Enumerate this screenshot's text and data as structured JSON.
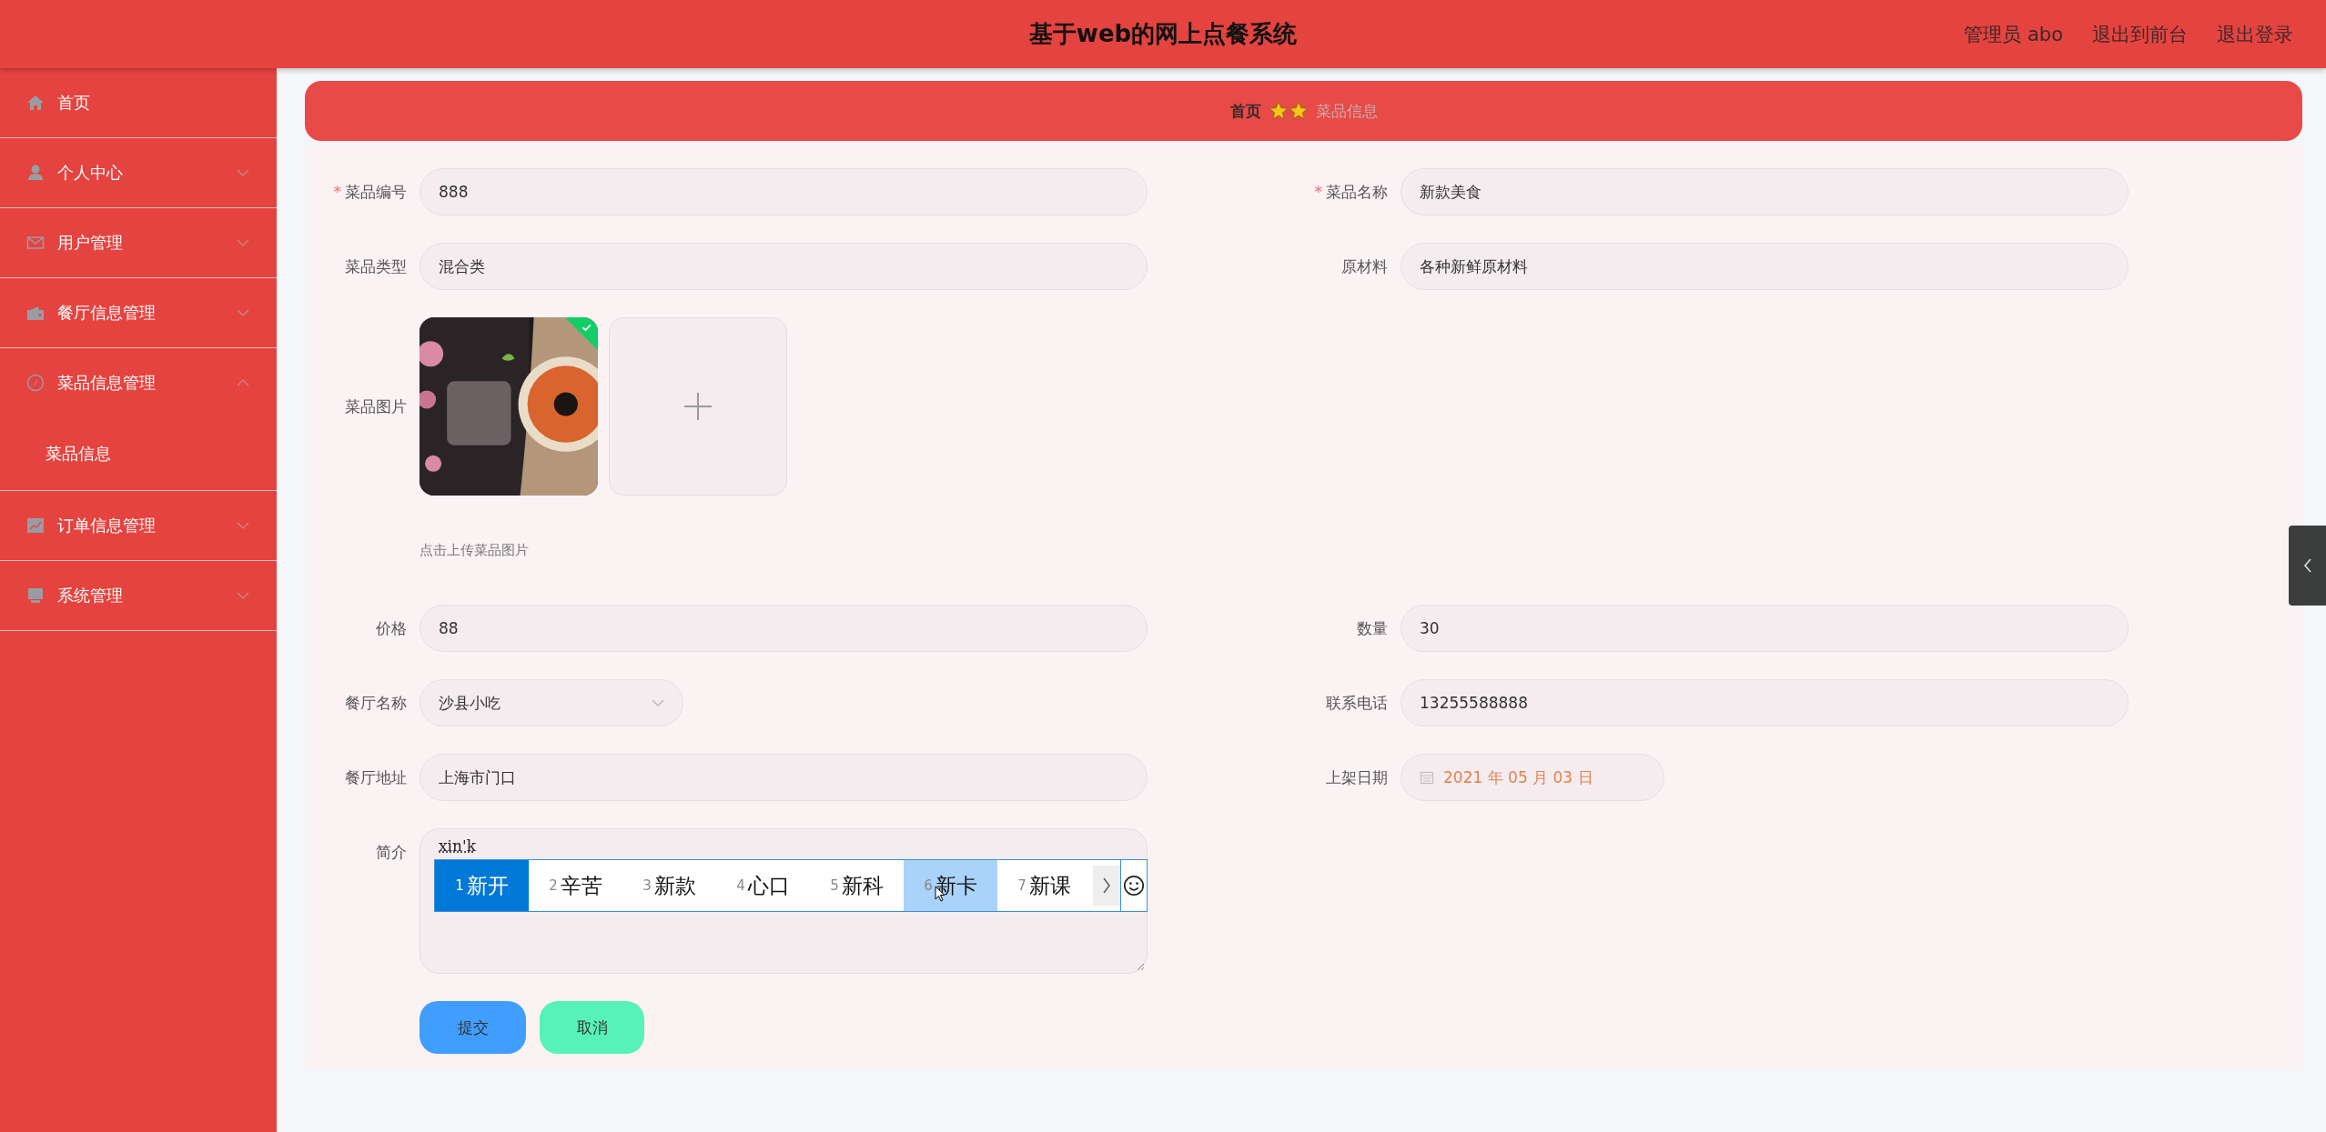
{
  "header": {
    "title": "基于web的网上点餐系统",
    "user": "管理员 abo",
    "links": [
      "退出到前台",
      "退出登录"
    ]
  },
  "sidebar": {
    "items": [
      {
        "label": "首页"
      },
      {
        "label": "个人中心",
        "expanded": false
      },
      {
        "label": "用户管理",
        "expanded": false
      },
      {
        "label": "餐厅信息管理",
        "expanded": false
      },
      {
        "label": "菜品信息管理",
        "expanded": true,
        "children": [
          {
            "label": "菜品信息"
          }
        ]
      },
      {
        "label": "订单信息管理",
        "expanded": false
      },
      {
        "label": "系统管理",
        "expanded": false
      }
    ]
  },
  "breadcrumb": [
    "首页",
    "菜品信息"
  ],
  "form": {
    "rows": [
      [
        {
          "kind": "text",
          "label": "菜品编号",
          "required_mark": "*",
          "value": "888"
        },
        {
          "kind": "text",
          "label": "菜品名称",
          "required_mark": "*",
          "value": "新款美食"
        }
      ],
      [
        {
          "kind": "text",
          "label": "菜品类型",
          "value": "混合类"
        },
        {
          "kind": "text",
          "label": "原材料",
          "value": "各种新鲜原材料"
        }
      ],
      [
        {
          "kind": "upload",
          "label": "菜品图片",
          "uploaded": true,
          "hint": "点击上传菜品图片"
        }
      ],
      [
        {
          "kind": "text",
          "label": "价格",
          "value": "88"
        },
        {
          "kind": "text",
          "label": "数量",
          "value": "30"
        }
      ],
      [
        {
          "kind": "select",
          "label": "餐厅名称",
          "value": "沙县小吃"
        },
        {
          "kind": "text",
          "label": "联系电话",
          "value": "13255588888"
        }
      ],
      [
        {
          "kind": "text",
          "label": "餐厅地址",
          "value": "上海市门口"
        },
        {
          "kind": "date",
          "label": "上架日期",
          "value": "2021 年 05 月 03 日"
        }
      ],
      [
        {
          "kind": "textarea",
          "label": "简介",
          "value": "xin'k"
        }
      ]
    ],
    "buttons": [
      {
        "kind": "primary",
        "label": "提交"
      },
      {
        "kind": "secondary",
        "label": "取消"
      }
    ]
  },
  "ime": {
    "candidates": [
      {
        "number": "1",
        "text": "新开",
        "selected": true,
        "hovered": false
      },
      {
        "number": "2",
        "text": "辛苦",
        "selected": false,
        "hovered": false
      },
      {
        "number": "3",
        "text": "新款",
        "selected": false,
        "hovered": false
      },
      {
        "number": "4",
        "text": "心口",
        "selected": false,
        "hovered": false
      },
      {
        "number": "5",
        "text": "新科",
        "selected": false,
        "hovered": false
      },
      {
        "number": "6",
        "text": "新卡",
        "selected": false,
        "hovered": true
      },
      {
        "number": "7",
        "text": "新课",
        "selected": false,
        "hovered": false
      }
    ]
  }
}
